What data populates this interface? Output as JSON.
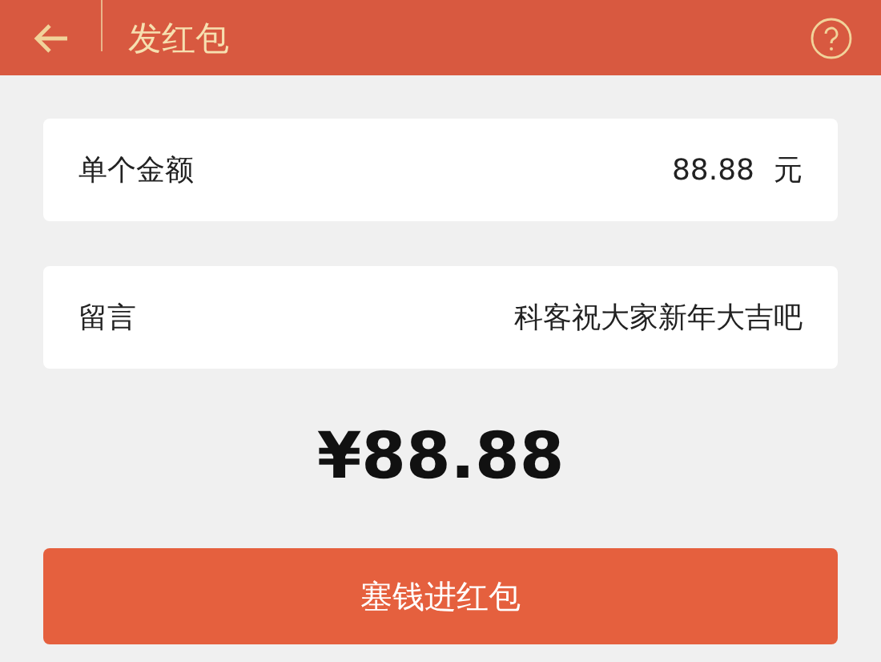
{
  "header": {
    "title": "发红包"
  },
  "fields": [
    {
      "label": "单个金额",
      "value": "88.88",
      "unit": "元"
    },
    {
      "label": "留言",
      "value": "科客祝大家新年大吉吧"
    }
  ],
  "total": "¥88.88",
  "submit_button": "塞钱进红包"
}
